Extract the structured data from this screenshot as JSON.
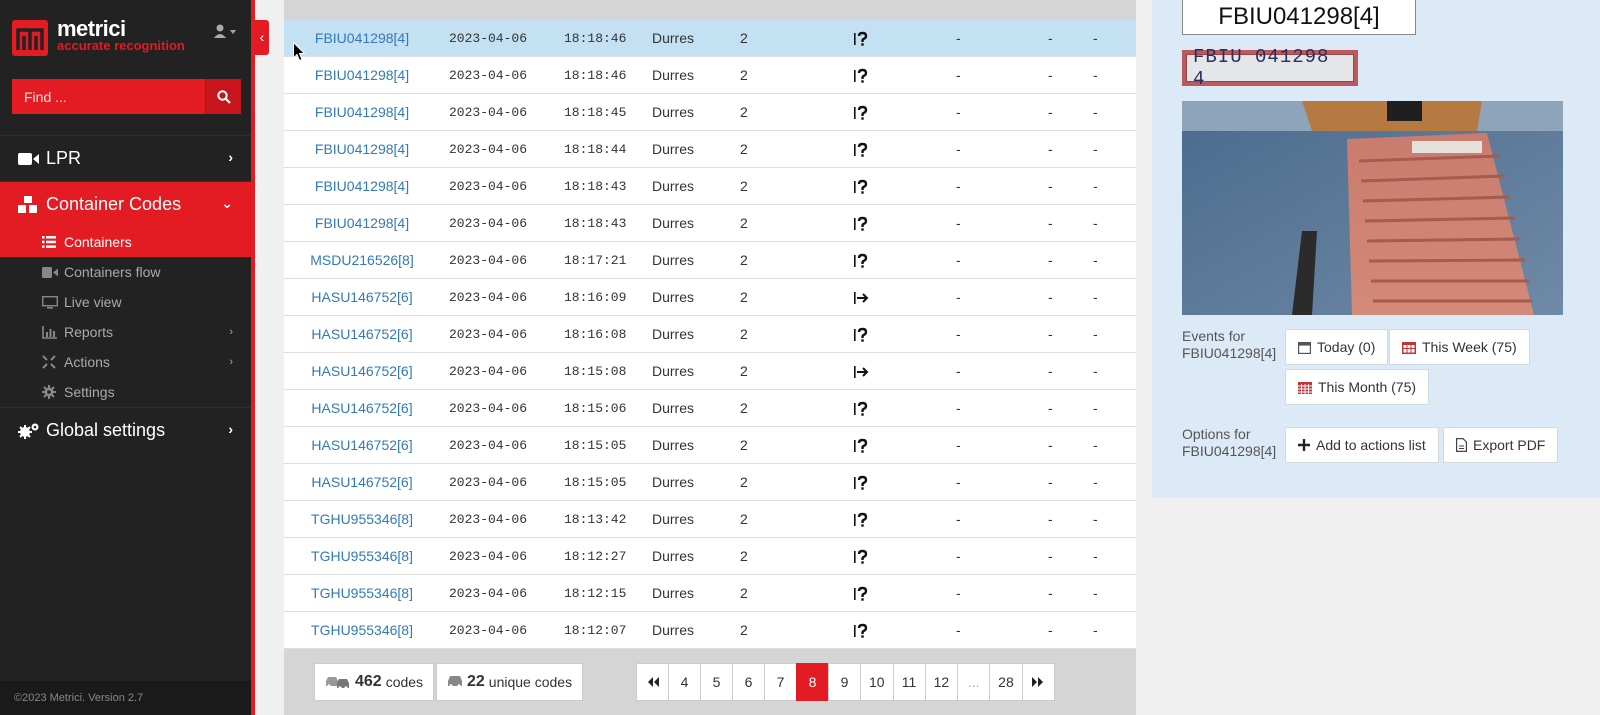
{
  "brand": {
    "name": "metrici",
    "tagline": "accurate recognition"
  },
  "search": {
    "placeholder": "Find ..."
  },
  "nav": {
    "lpr": "LPR",
    "container_codes": "Container Codes",
    "sub": [
      {
        "label": "Containers",
        "icon": "list-icon",
        "active": true
      },
      {
        "label": "Containers flow",
        "icon": "video-icon"
      },
      {
        "label": "Live view",
        "icon": "monitor-icon"
      },
      {
        "label": "Reports",
        "icon": "chart-icon",
        "submenu": true
      },
      {
        "label": "Actions",
        "icon": "actions-icon",
        "submenu": true
      },
      {
        "label": "Settings",
        "icon": "gear-icon"
      }
    ],
    "global_settings": "Global settings"
  },
  "footer": "©2023 Metrici. Version 2.7",
  "rows": [
    {
      "code": "FBIU041298[4]",
      "date": "2023-04-06",
      "time": "18:18:46",
      "place": "Durres",
      "lane": "2",
      "dir": "unknown",
      "d1": "-",
      "d2": "-",
      "d3": "-",
      "selected": true
    },
    {
      "code": "FBIU041298[4]",
      "date": "2023-04-06",
      "time": "18:18:46",
      "place": "Durres",
      "lane": "2",
      "dir": "unknown",
      "d1": "-",
      "d2": "-",
      "d3": "-"
    },
    {
      "code": "FBIU041298[4]",
      "date": "2023-04-06",
      "time": "18:18:45",
      "place": "Durres",
      "lane": "2",
      "dir": "unknown",
      "d1": "-",
      "d2": "-",
      "d3": "-"
    },
    {
      "code": "FBIU041298[4]",
      "date": "2023-04-06",
      "time": "18:18:44",
      "place": "Durres",
      "lane": "2",
      "dir": "unknown",
      "d1": "-",
      "d2": "-",
      "d3": "-"
    },
    {
      "code": "FBIU041298[4]",
      "date": "2023-04-06",
      "time": "18:18:43",
      "place": "Durres",
      "lane": "2",
      "dir": "unknown",
      "d1": "-",
      "d2": "-",
      "d3": "-"
    },
    {
      "code": "FBIU041298[4]",
      "date": "2023-04-06",
      "time": "18:18:43",
      "place": "Durres",
      "lane": "2",
      "dir": "unknown",
      "d1": "-",
      "d2": "-",
      "d3": "-"
    },
    {
      "code": "MSDU216526[8]",
      "date": "2023-04-06",
      "time": "18:17:21",
      "place": "Durres",
      "lane": "2",
      "dir": "unknown",
      "d1": "-",
      "d2": "-",
      "d3": "-"
    },
    {
      "code": "HASU146752[6]",
      "date": "2023-04-06",
      "time": "18:16:09",
      "place": "Durres",
      "lane": "2",
      "dir": "out",
      "d1": "-",
      "d2": "-",
      "d3": "-"
    },
    {
      "code": "HASU146752[6]",
      "date": "2023-04-06",
      "time": "18:16:08",
      "place": "Durres",
      "lane": "2",
      "dir": "unknown",
      "d1": "-",
      "d2": "-",
      "d3": "-"
    },
    {
      "code": "HASU146752[6]",
      "date": "2023-04-06",
      "time": "18:15:08",
      "place": "Durres",
      "lane": "2",
      "dir": "out",
      "d1": "-",
      "d2": "-",
      "d3": "-"
    },
    {
      "code": "HASU146752[6]",
      "date": "2023-04-06",
      "time": "18:15:06",
      "place": "Durres",
      "lane": "2",
      "dir": "unknown",
      "d1": "-",
      "d2": "-",
      "d3": "-"
    },
    {
      "code": "HASU146752[6]",
      "date": "2023-04-06",
      "time": "18:15:05",
      "place": "Durres",
      "lane": "2",
      "dir": "unknown",
      "d1": "-",
      "d2": "-",
      "d3": "-"
    },
    {
      "code": "HASU146752[6]",
      "date": "2023-04-06",
      "time": "18:15:05",
      "place": "Durres",
      "lane": "2",
      "dir": "unknown",
      "d1": "-",
      "d2": "-",
      "d3": "-"
    },
    {
      "code": "TGHU955346[8]",
      "date": "2023-04-06",
      "time": "18:13:42",
      "place": "Durres",
      "lane": "2",
      "dir": "unknown",
      "d1": "-",
      "d2": "-",
      "d3": "-"
    },
    {
      "code": "TGHU955346[8]",
      "date": "2023-04-06",
      "time": "18:12:27",
      "place": "Durres",
      "lane": "2",
      "dir": "unknown",
      "d1": "-",
      "d2": "-",
      "d3": "-"
    },
    {
      "code": "TGHU955346[8]",
      "date": "2023-04-06",
      "time": "18:12:15",
      "place": "Durres",
      "lane": "2",
      "dir": "unknown",
      "d1": "-",
      "d2": "-",
      "d3": "-"
    },
    {
      "code": "TGHU955346[8]",
      "date": "2023-04-06",
      "time": "18:12:07",
      "place": "Durres",
      "lane": "2",
      "dir": "unknown",
      "d1": "-",
      "d2": "-",
      "d3": "-"
    }
  ],
  "counts": {
    "codes_num": "462",
    "codes_label": "codes",
    "unique_num": "22",
    "unique_label": "unique codes"
  },
  "pagination": {
    "pages": [
      "4",
      "5",
      "6",
      "7",
      "8",
      "9",
      "10",
      "11",
      "12",
      "...",
      "28"
    ],
    "active": "8"
  },
  "detail": {
    "plate": "FBIU041298[4]",
    "plate_crop_text": "FBIU 041298 4",
    "events_label": "Events for",
    "events_code": "FBIU041298[4]",
    "today": "Today (0)",
    "week": "This Week (75)",
    "month": "This Month (75)",
    "options_label": "Options for",
    "options_code": "FBIU041298[4]",
    "add_actions": "Add to actions list",
    "export_pdf": "Export PDF"
  },
  "colors": {
    "accent": "#e31b23",
    "sidebar": "#222222",
    "link": "#337ab7",
    "selected_row": "#c4e0f3",
    "panel": "#dce9f6"
  }
}
